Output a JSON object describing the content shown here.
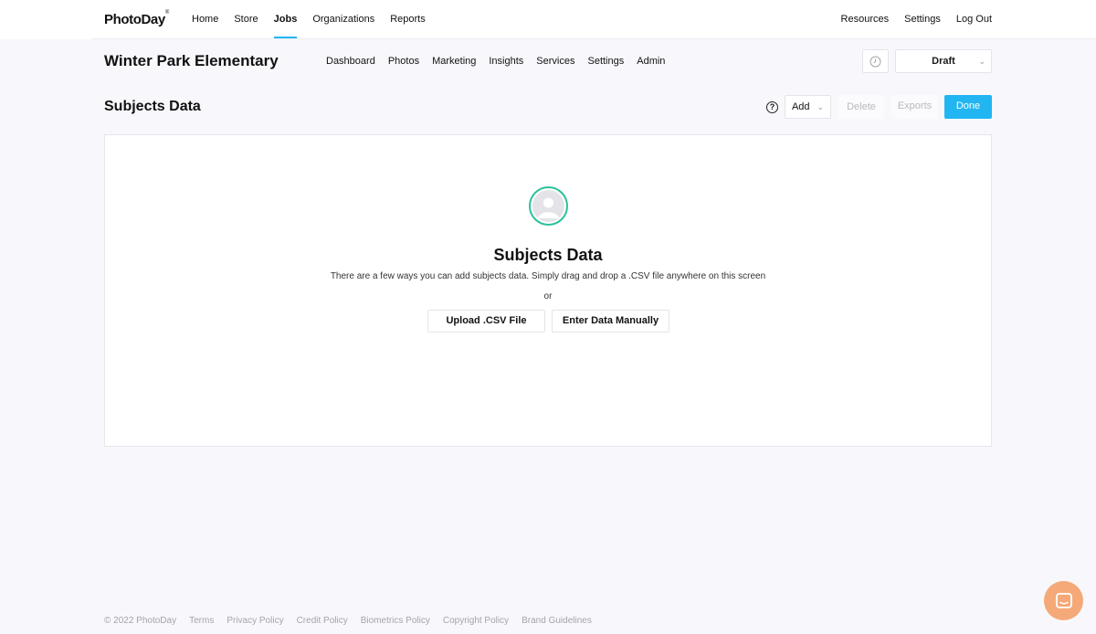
{
  "brand": {
    "name": "PhotoDay",
    "mark": "®"
  },
  "topnav": {
    "items": [
      {
        "label": "Home"
      },
      {
        "label": "Store"
      },
      {
        "label": "Jobs",
        "active": true
      },
      {
        "label": "Organizations"
      },
      {
        "label": "Reports"
      }
    ],
    "right": [
      {
        "label": "Resources"
      },
      {
        "label": "Settings"
      },
      {
        "label": "Log Out"
      }
    ]
  },
  "job": {
    "title": "Winter Park Elementary",
    "tabs": [
      {
        "label": "Dashboard"
      },
      {
        "label": "Photos"
      },
      {
        "label": "Marketing"
      },
      {
        "label": "Insights"
      },
      {
        "label": "Services"
      },
      {
        "label": "Settings"
      },
      {
        "label": "Admin"
      }
    ],
    "status": "Draft"
  },
  "section": {
    "title": "Subjects Data",
    "help_glyph": "?",
    "add_label": "Add",
    "delete_label": "Delete",
    "exports_label": "Exports",
    "done_label": "Done"
  },
  "empty_state": {
    "title": "Subjects Data",
    "description": "There are a few ways you can add subjects data. Simply drag and drop a .CSV file anywhere on this screen",
    "or_text": "or",
    "upload_label": "Upload .CSV File",
    "manual_label": "Enter Data Manually"
  },
  "footer": {
    "items": [
      {
        "label": "© 2022 PhotoDay"
      },
      {
        "label": "Terms"
      },
      {
        "label": "Privacy Policy"
      },
      {
        "label": "Credit Policy"
      },
      {
        "label": "Biometrics Policy"
      },
      {
        "label": "Copyright Policy"
      },
      {
        "label": "Brand Guidelines"
      }
    ]
  },
  "colors": {
    "accent": "#21b6f2",
    "avatar_ring": "#2bc19a",
    "chat": "#f5a978"
  },
  "icons": {
    "clock": "clock-icon",
    "help": "help-icon",
    "avatar": "user-avatar-icon",
    "chat": "chat-icon"
  }
}
